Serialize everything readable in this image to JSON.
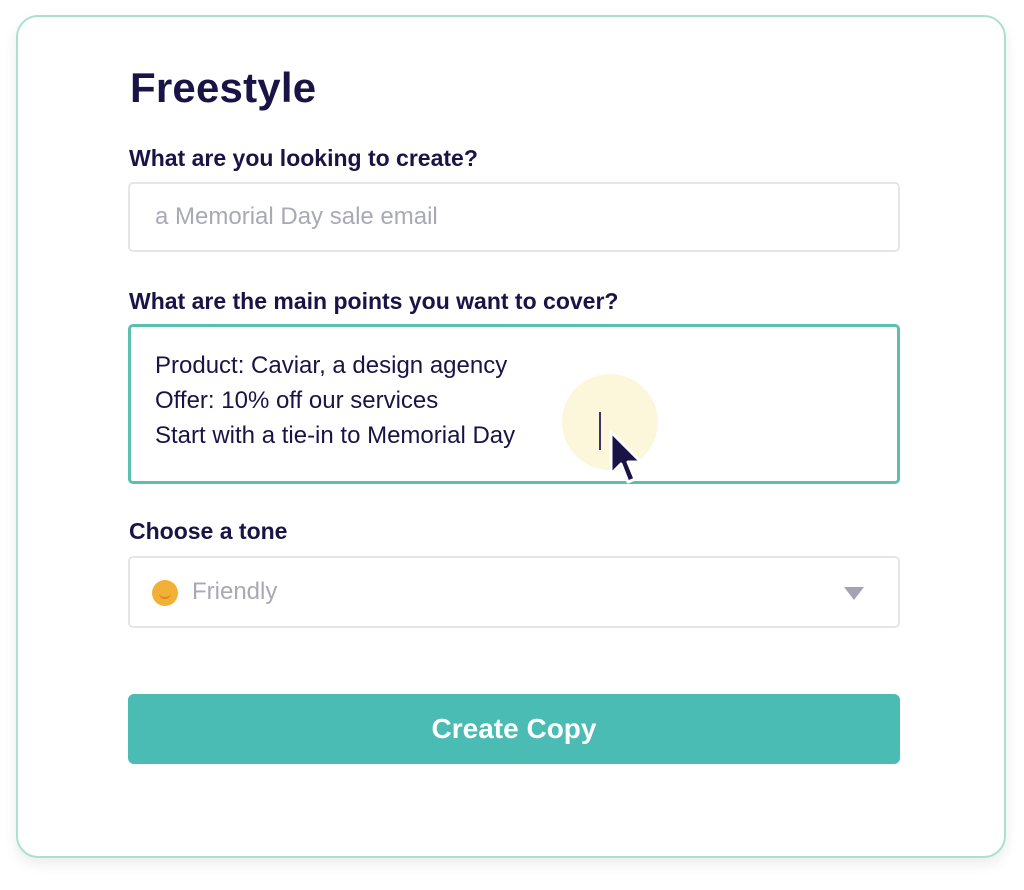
{
  "form": {
    "title": "Freestyle",
    "create_label": "What are you looking to create?",
    "create_placeholder": "a Memorial Day sale email",
    "points_label": "What are the main points you want to cover?",
    "points_lines": [
      "Product: Caviar, a design agency",
      "Offer: 10% off our services",
      "Start with a tie-in to Memorial Day"
    ],
    "tone_label": "Choose a tone",
    "tone_icon": "smiling-emoji-icon",
    "tone_value": "Friendly",
    "submit_label": "Create Copy"
  },
  "colors": {
    "heading": "#1a1446",
    "accent": "#4bbcb3",
    "focus_border": "#5bbfb0",
    "card_border": "#a8e2cf",
    "placeholder": "#a9a9b6"
  }
}
